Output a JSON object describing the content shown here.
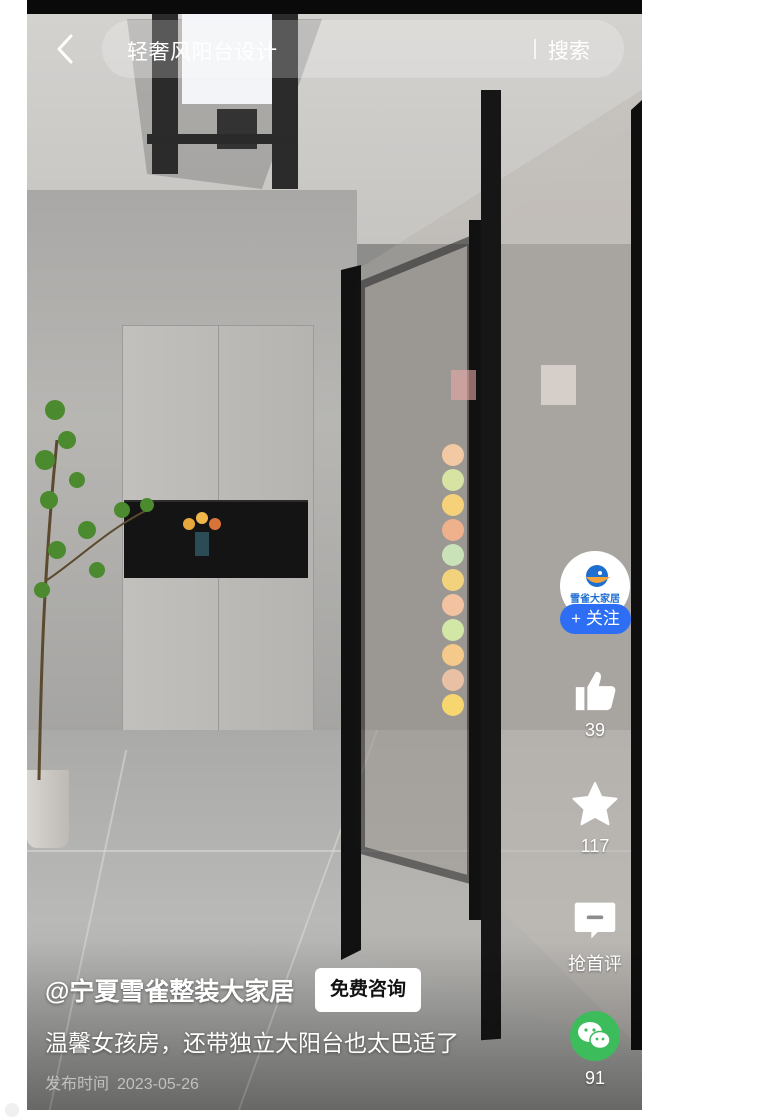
{
  "search": {
    "query": "轻奢风阳台设计",
    "button_label": "搜索"
  },
  "creator": {
    "avatar_text": "雪雀大家居",
    "follow_label": "+ 关注"
  },
  "actions": {
    "like_count": "39",
    "favorite_count": "117",
    "comment_label": "抢首评",
    "share_count": "91"
  },
  "post": {
    "author": "@宁夏雪雀整装大家居",
    "consult_label": "免费咨询",
    "description": "温馨女孩房，还带独立大阳台也太巴适了",
    "published_label": "发布时间",
    "published_date": "2023-05-26"
  },
  "icons": {
    "back": "chevron-left-icon",
    "like": "thumbs-up-icon",
    "favorite": "star-icon",
    "comment": "comment-icon",
    "share": "wechat-icon"
  },
  "colors": {
    "follow": "#2d6ef5",
    "wechat": "#3cbc5a"
  }
}
